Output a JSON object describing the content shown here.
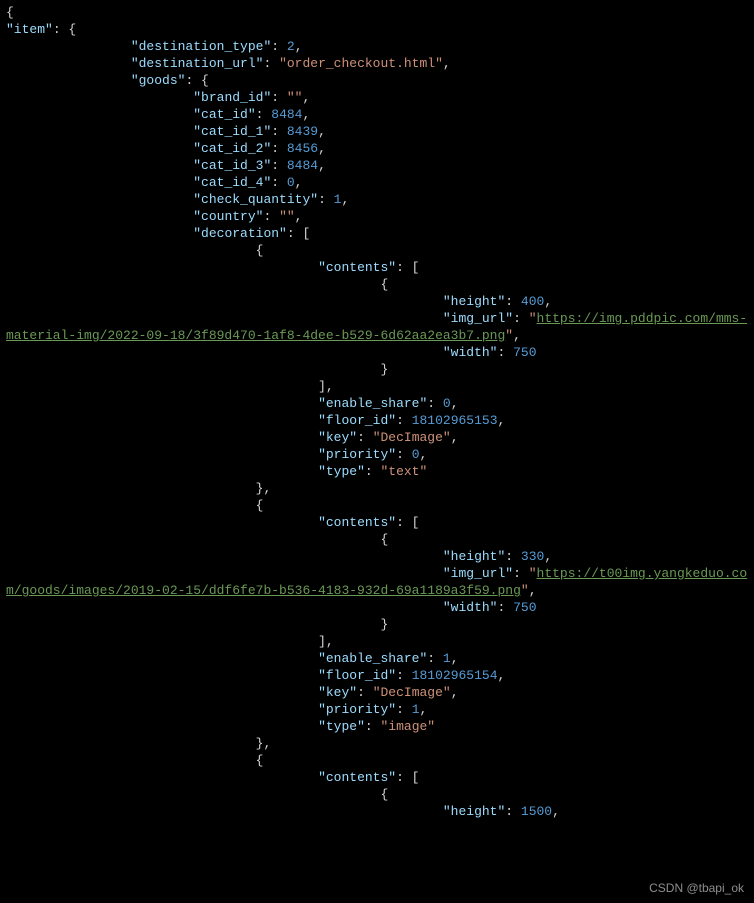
{
  "watermark": "CSDN @tbapi_ok",
  "tokens": [
    [
      "p",
      "{\n"
    ],
    [
      "k",
      "\"item\""
    ],
    [
      "p",
      ": {\n"
    ],
    [
      "p",
      "                "
    ],
    [
      "k",
      "\"destination_type\""
    ],
    [
      "p",
      ": "
    ],
    [
      "n",
      "2"
    ],
    [
      "p",
      ",\n"
    ],
    [
      "p",
      "                "
    ],
    [
      "k",
      "\"destination_url\""
    ],
    [
      "p",
      ": "
    ],
    [
      "s",
      "\"order_checkout.html\""
    ],
    [
      "p",
      ",\n"
    ],
    [
      "p",
      "                "
    ],
    [
      "k",
      "\"goods\""
    ],
    [
      "p",
      ": {\n"
    ],
    [
      "p",
      "                        "
    ],
    [
      "k",
      "\"brand_id\""
    ],
    [
      "p",
      ": "
    ],
    [
      "s",
      "\"\""
    ],
    [
      "p",
      ",\n"
    ],
    [
      "p",
      "                        "
    ],
    [
      "k",
      "\"cat_id\""
    ],
    [
      "p",
      ": "
    ],
    [
      "n",
      "8484"
    ],
    [
      "p",
      ",\n"
    ],
    [
      "p",
      "                        "
    ],
    [
      "k",
      "\"cat_id_1\""
    ],
    [
      "p",
      ": "
    ],
    [
      "n",
      "8439"
    ],
    [
      "p",
      ",\n"
    ],
    [
      "p",
      "                        "
    ],
    [
      "k",
      "\"cat_id_2\""
    ],
    [
      "p",
      ": "
    ],
    [
      "n",
      "8456"
    ],
    [
      "p",
      ",\n"
    ],
    [
      "p",
      "                        "
    ],
    [
      "k",
      "\"cat_id_3\""
    ],
    [
      "p",
      ": "
    ],
    [
      "n",
      "8484"
    ],
    [
      "p",
      ",\n"
    ],
    [
      "p",
      "                        "
    ],
    [
      "k",
      "\"cat_id_4\""
    ],
    [
      "p",
      ": "
    ],
    [
      "n",
      "0"
    ],
    [
      "p",
      ",\n"
    ],
    [
      "p",
      "                        "
    ],
    [
      "k",
      "\"check_quantity\""
    ],
    [
      "p",
      ": "
    ],
    [
      "n",
      "1"
    ],
    [
      "p",
      ",\n"
    ],
    [
      "p",
      "                        "
    ],
    [
      "k",
      "\"country\""
    ],
    [
      "p",
      ": "
    ],
    [
      "s",
      "\"\""
    ],
    [
      "p",
      ",\n"
    ],
    [
      "p",
      "                        "
    ],
    [
      "k",
      "\"decoration\""
    ],
    [
      "p",
      ": [\n"
    ],
    [
      "p",
      "                                {\n"
    ],
    [
      "p",
      "                                        "
    ],
    [
      "k",
      "\"contents\""
    ],
    [
      "p",
      ": [\n"
    ],
    [
      "p",
      "                                                {\n"
    ],
    [
      "p",
      "                                                        "
    ],
    [
      "k",
      "\"height\""
    ],
    [
      "p",
      ": "
    ],
    [
      "n",
      "400"
    ],
    [
      "p",
      ",\n"
    ],
    [
      "p",
      "                                                        "
    ],
    [
      "k",
      "\"img_url\""
    ],
    [
      "p",
      ": "
    ],
    [
      "s",
      "\""
    ],
    [
      "su",
      "https://img.pddpic.com/mms-material-img/2022-09-18/3f89d470-1af8-4dee-b529-6d62aa2ea3b7.png"
    ],
    [
      "s",
      "\""
    ],
    [
      "p",
      ",\n"
    ],
    [
      "p",
      "                                                        "
    ],
    [
      "k",
      "\"width\""
    ],
    [
      "p",
      ": "
    ],
    [
      "n",
      "750"
    ],
    [
      "p",
      "\n"
    ],
    [
      "p",
      "                                                }\n"
    ],
    [
      "p",
      "                                        ],\n"
    ],
    [
      "p",
      "                                        "
    ],
    [
      "k",
      "\"enable_share\""
    ],
    [
      "p",
      ": "
    ],
    [
      "n",
      "0"
    ],
    [
      "p",
      ",\n"
    ],
    [
      "p",
      "                                        "
    ],
    [
      "k",
      "\"floor_id\""
    ],
    [
      "p",
      ": "
    ],
    [
      "n",
      "18102965153"
    ],
    [
      "p",
      ",\n"
    ],
    [
      "p",
      "                                        "
    ],
    [
      "k",
      "\"key\""
    ],
    [
      "p",
      ": "
    ],
    [
      "s",
      "\"DecImage\""
    ],
    [
      "p",
      ",\n"
    ],
    [
      "p",
      "                                        "
    ],
    [
      "k",
      "\"priority\""
    ],
    [
      "p",
      ": "
    ],
    [
      "n",
      "0"
    ],
    [
      "p",
      ",\n"
    ],
    [
      "p",
      "                                        "
    ],
    [
      "k",
      "\"type\""
    ],
    [
      "p",
      ": "
    ],
    [
      "s",
      "\"text\""
    ],
    [
      "p",
      "\n"
    ],
    [
      "p",
      "                                },\n"
    ],
    [
      "p",
      "                                {\n"
    ],
    [
      "p",
      "                                        "
    ],
    [
      "k",
      "\"contents\""
    ],
    [
      "p",
      ": [\n"
    ],
    [
      "p",
      "                                                {\n"
    ],
    [
      "p",
      "                                                        "
    ],
    [
      "k",
      "\"height\""
    ],
    [
      "p",
      ": "
    ],
    [
      "n",
      "330"
    ],
    [
      "p",
      ",\n"
    ],
    [
      "p",
      "                                                        "
    ],
    [
      "k",
      "\"img_url\""
    ],
    [
      "p",
      ": "
    ],
    [
      "s",
      "\""
    ],
    [
      "su",
      "https://t00img.yangkeduo.com/goods/images/2019-02-15/ddf6fe7b-b536-4183-932d-69a1189a3f59.png"
    ],
    [
      "s",
      "\""
    ],
    [
      "p",
      ",\n"
    ],
    [
      "p",
      "                                                        "
    ],
    [
      "k",
      "\"width\""
    ],
    [
      "p",
      ": "
    ],
    [
      "n",
      "750"
    ],
    [
      "p",
      "\n"
    ],
    [
      "p",
      "                                                }\n"
    ],
    [
      "p",
      "                                        ],\n"
    ],
    [
      "p",
      "                                        "
    ],
    [
      "k",
      "\"enable_share\""
    ],
    [
      "p",
      ": "
    ],
    [
      "n",
      "1"
    ],
    [
      "p",
      ",\n"
    ],
    [
      "p",
      "                                        "
    ],
    [
      "k",
      "\"floor_id\""
    ],
    [
      "p",
      ": "
    ],
    [
      "n",
      "18102965154"
    ],
    [
      "p",
      ",\n"
    ],
    [
      "p",
      "                                        "
    ],
    [
      "k",
      "\"key\""
    ],
    [
      "p",
      ": "
    ],
    [
      "s",
      "\"DecImage\""
    ],
    [
      "p",
      ",\n"
    ],
    [
      "p",
      "                                        "
    ],
    [
      "k",
      "\"priority\""
    ],
    [
      "p",
      ": "
    ],
    [
      "n",
      "1"
    ],
    [
      "p",
      ",\n"
    ],
    [
      "p",
      "                                        "
    ],
    [
      "k",
      "\"type\""
    ],
    [
      "p",
      ": "
    ],
    [
      "s",
      "\"image\""
    ],
    [
      "p",
      "\n"
    ],
    [
      "p",
      "                                },\n"
    ],
    [
      "p",
      "                                {\n"
    ],
    [
      "p",
      "                                        "
    ],
    [
      "k",
      "\"contents\""
    ],
    [
      "p",
      ": [\n"
    ],
    [
      "p",
      "                                                {\n"
    ],
    [
      "p",
      "                                                        "
    ],
    [
      "k",
      "\"height\""
    ],
    [
      "p",
      ": "
    ],
    [
      "n",
      "1500"
    ],
    [
      "p",
      ",\n"
    ]
  ]
}
